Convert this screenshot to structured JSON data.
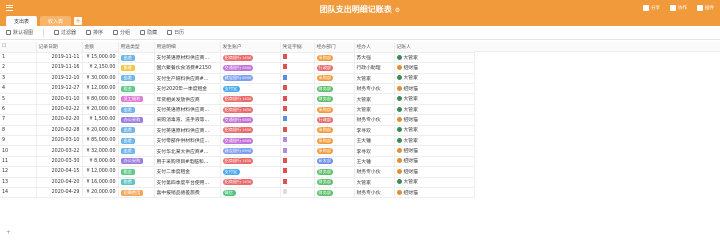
{
  "app": {
    "title": "团队支出明细记账表",
    "actions": [
      {
        "label": "分享",
        "icon": "share-icon"
      },
      {
        "label": "协作",
        "icon": "collaborate-icon"
      },
      {
        "label": "插件",
        "icon": "plugin-icon"
      }
    ],
    "tabs": [
      {
        "label": "支出表",
        "active": true
      },
      {
        "label": "收入表",
        "active": false
      }
    ]
  },
  "toolbar": {
    "items": [
      "默认视图",
      "过滤器",
      "排序",
      "分组",
      "隐藏",
      "日历"
    ]
  },
  "columns": [
    "记录日期",
    "金额",
    "用途类型",
    "用途明细",
    "发生账户",
    "凭证字据",
    "经办部门",
    "经办人",
    "记账人"
  ],
  "colors": {
    "header": "#f19a3c",
    "type": {
      "出差": "#6fb6e8",
      "聚餐": "#f4c542",
      "租金": "#5fc98a",
      "员工福利": "#e07bd3",
      "采购": "#8f90e8",
      "办公采购": "#9b7ce0",
      "税费": "#5cc4c4",
      "招聘费用": "#f2a65a"
    },
    "account": {
      "招商银行": "#e96b6b",
      "交通银行": "#c471d8",
      "建设银行": "#7da0f0",
      "支付宝": "#49a8f2",
      "微信": "#4fc37a"
    },
    "dept": {
      "采购部": "#f19a3c",
      "行政部": "#e56b6b",
      "财务部": "#5cbf6a",
      "研发部": "#6a8de8"
    }
  },
  "rows": [
    {
      "no": "1",
      "date": "2019-11-11",
      "amount": "¥ 15,000.00",
      "type": "出差",
      "detail": "支付英语原材料供应商...",
      "account": "招商银行",
      "acct_no": "1658",
      "dept": "采购部",
      "handler": "苏大强",
      "recorder": "大管家",
      "doc": "pdf"
    },
    {
      "no": "2",
      "date": "2019-11-16",
      "amount": "¥ 2,150.00",
      "type": "聚餐",
      "detail": "国六聚餐伙食消费#2150",
      "account": "交通银行",
      "acct_no": "6868",
      "dept": "行政部",
      "handler": "行政小助理",
      "recorder": "招财猫",
      "doc": "pdf"
    },
    {
      "no": "3",
      "date": "2019-12-10",
      "amount": "¥ 30,000.00",
      "type": "出差",
      "detail": "支付生产研料供应商#...",
      "account": "建设银行",
      "acct_no": "8998",
      "dept": "采购部",
      "handler": "大管家",
      "recorder": "大管家",
      "doc": "doc"
    },
    {
      "no": "4",
      "date": "2019-12-27",
      "amount": "¥ 12,000.00",
      "type": "租金",
      "detail": "支付2020年一季度租金",
      "account": "支付宝",
      "acct_no": "",
      "dept": "财务部",
      "handler": "财务专小伙",
      "recorder": "招财猫",
      "doc": "pdf"
    },
    {
      "no": "5",
      "date": "2020-01-10",
      "amount": "¥ 80,000.00",
      "type": "员工福利",
      "detail": "年货相关发放供应商",
      "account": "招商银行",
      "acct_no": "1658",
      "dept": "财务部",
      "handler": "大管家",
      "recorder": "大管家",
      "doc": "pdf"
    },
    {
      "no": "6",
      "date": "2020-02-22",
      "amount": "¥ 20,000.00",
      "type": "出差",
      "detail": "支付英语原材料供应商...",
      "account": "招商银行",
      "acct_no": "1658",
      "dept": "采购部",
      "handler": "大管家",
      "recorder": "大管家",
      "doc": "pdf"
    },
    {
      "no": "7",
      "date": "2020-02-20",
      "amount": "¥ 1,500.00",
      "type": "办公采购",
      "detail": "采购消毒液、洗手液等...",
      "account": "交通银行",
      "acct_no": "6868",
      "dept": "行政部",
      "handler": "财务专小伙",
      "recorder": "招财猫",
      "doc": "doc"
    },
    {
      "no": "8",
      "date": "2020-02-28",
      "amount": "¥ 20,000.00",
      "type": "出差",
      "detail": "支付英语原材料供应商...",
      "account": "招商银行",
      "acct_no": "1658",
      "dept": "采购部",
      "handler": "李寻欢",
      "recorder": "大管家",
      "doc": "pdf"
    },
    {
      "no": "9",
      "date": "2020-03-10",
      "amount": "¥ 85,000.00",
      "type": "出差",
      "detail": "支付零部件供材料供应...",
      "account": "交通银行",
      "acct_no": "6868",
      "dept": "采购部",
      "handler": "王大锤",
      "recorder": "大管家",
      "doc": "img"
    },
    {
      "no": "10",
      "date": "2020-03-22",
      "amount": "¥ 32,000.00",
      "type": "出差",
      "detail": "支付华北某大供应商#...",
      "account": "建设银行",
      "acct_no": "8998",
      "dept": "采购部",
      "handler": "李寻欢",
      "recorder": "招财猫",
      "doc": "img"
    },
    {
      "no": "11",
      "date": "2020-03-30",
      "amount": "¥ 8,000.00",
      "type": "办公采购",
      "detail": "用于采购项目#电脑和...",
      "account": "招商银行",
      "acct_no": "1658",
      "dept": "研发部",
      "handler": "王大锤",
      "recorder": "招财猫",
      "doc": "pdf"
    },
    {
      "no": "12",
      "date": "2020-04-15",
      "amount": "¥ 12,000.00",
      "type": "租金",
      "detail": "支付二季度租金",
      "account": "支付宝",
      "acct_no": "",
      "dept": "财务部",
      "handler": "财务专小伙",
      "recorder": "招财猫",
      "doc": "pdf"
    },
    {
      "no": "13",
      "date": "2020-04-20",
      "amount": "¥ 16,000.00",
      "type": "税费",
      "detail": "支付第四季度平台使用...",
      "account": "招商银行",
      "acct_no": "1658",
      "dept": "财务部",
      "handler": "大管家",
      "recorder": "大管家",
      "doc": "pdf"
    },
    {
      "no": "14",
      "date": "2020-04-29",
      "amount": "¥ 20,000.00",
      "type": "招聘费用",
      "detail": "喜中报销品德差旅费",
      "account": "微信",
      "acct_no": "",
      "dept": "财务部",
      "handler": "财务专小伙",
      "recorder": "招财猫",
      "doc": "blank"
    }
  ]
}
